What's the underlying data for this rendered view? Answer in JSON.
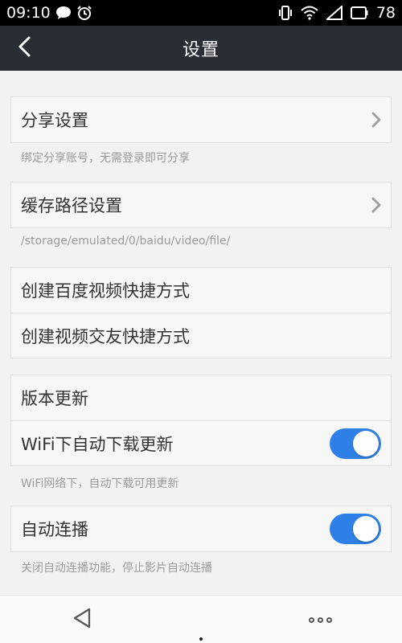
{
  "status_bar": {
    "time": "09:10",
    "battery": "78",
    "icons": [
      "chat-icon",
      "alarm-icon",
      "vibrate-icon",
      "wifi-icon",
      "signal-icon"
    ]
  },
  "nav": {
    "title": "设置",
    "back_icon": "chevron-left-icon"
  },
  "settings": {
    "share": {
      "label": "分享设置",
      "hint": "绑定分享账号，无需登录即可分享"
    },
    "cache": {
      "label": "缓存路径设置",
      "hint": "/storage/emulated/0/baidu/video/file/"
    },
    "shortcut_video": {
      "label": "创建百度视频快捷方式"
    },
    "shortcut_friend": {
      "label": "创建视频交友快捷方式"
    },
    "version": {
      "label": "版本更新"
    },
    "wifi_update": {
      "label": "WiFi下自动下载更新",
      "hint": "WiFi网络下，自动下载可用更新",
      "enabled": true
    },
    "autoplay": {
      "label": "自动连播",
      "hint": "关闭自动连播功能，停止影片自动连播",
      "enabled": true
    }
  },
  "colors": {
    "nav_bg": "#2b2d36",
    "toggle_on": "#2f80e6",
    "page_bg": "#f2f2f2"
  }
}
